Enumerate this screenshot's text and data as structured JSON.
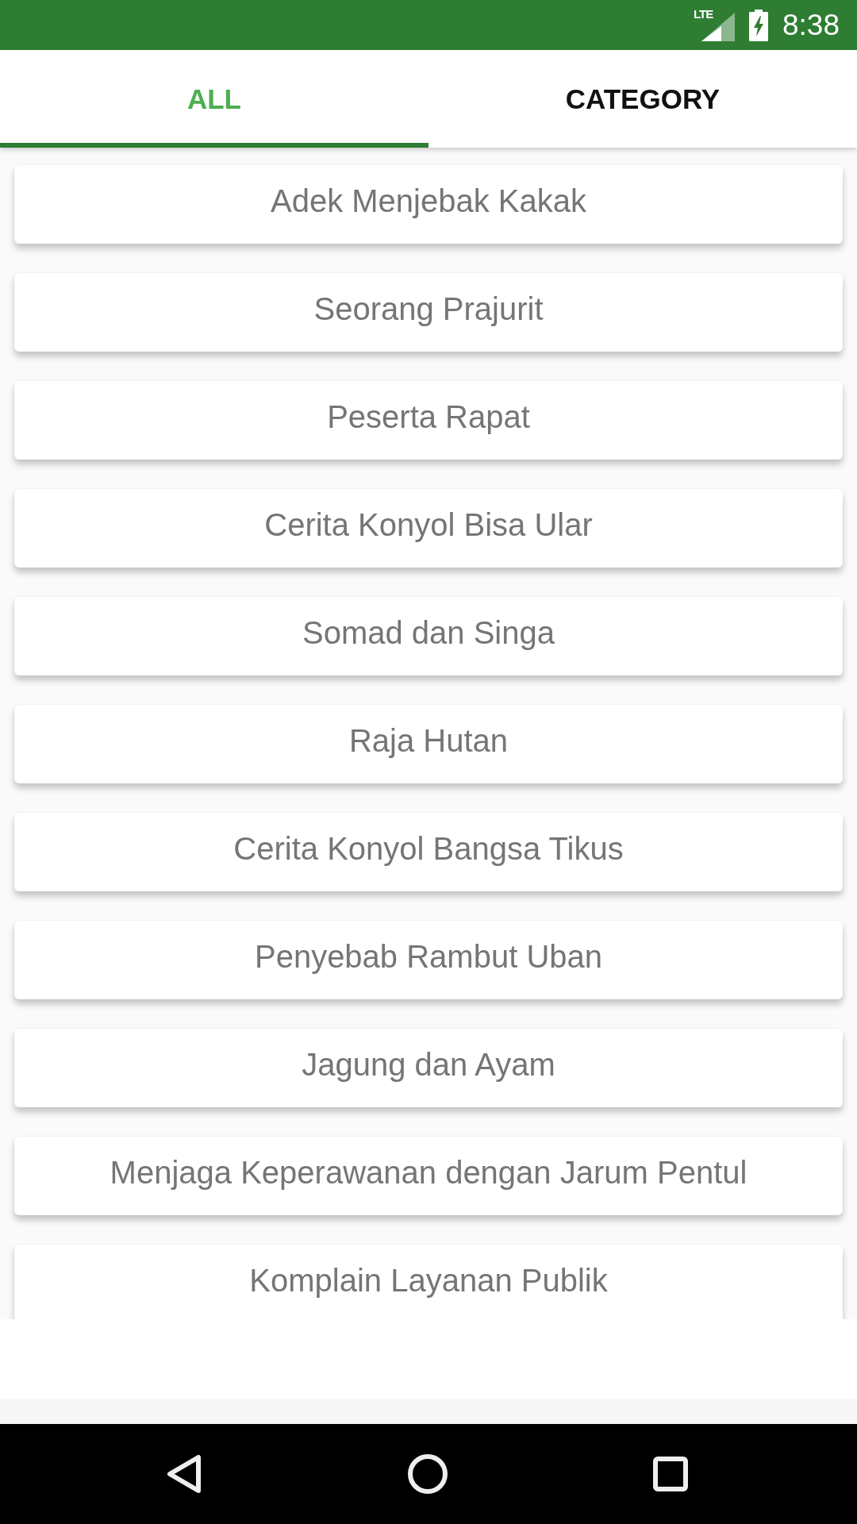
{
  "status_bar": {
    "network": "LTE",
    "time": "8:38"
  },
  "tabs": [
    {
      "label": "ALL",
      "selected": true
    },
    {
      "label": "CATEGORY",
      "selected": false
    }
  ],
  "stories": [
    {
      "title": "Adek Menjebak Kakak"
    },
    {
      "title": "Seorang Prajurit"
    },
    {
      "title": "Peserta Rapat"
    },
    {
      "title": "Cerita Konyol Bisa Ular"
    },
    {
      "title": "Somad dan Singa"
    },
    {
      "title": "Raja Hutan"
    },
    {
      "title": "Cerita Konyol Bangsa Tikus"
    },
    {
      "title": "Penyebab Rambut Uban"
    },
    {
      "title": "Jagung dan Ayam"
    },
    {
      "title": "Menjaga Keperawanan dengan Jarum Pentul"
    },
    {
      "title": "Komplain Layanan Publik"
    }
  ]
}
